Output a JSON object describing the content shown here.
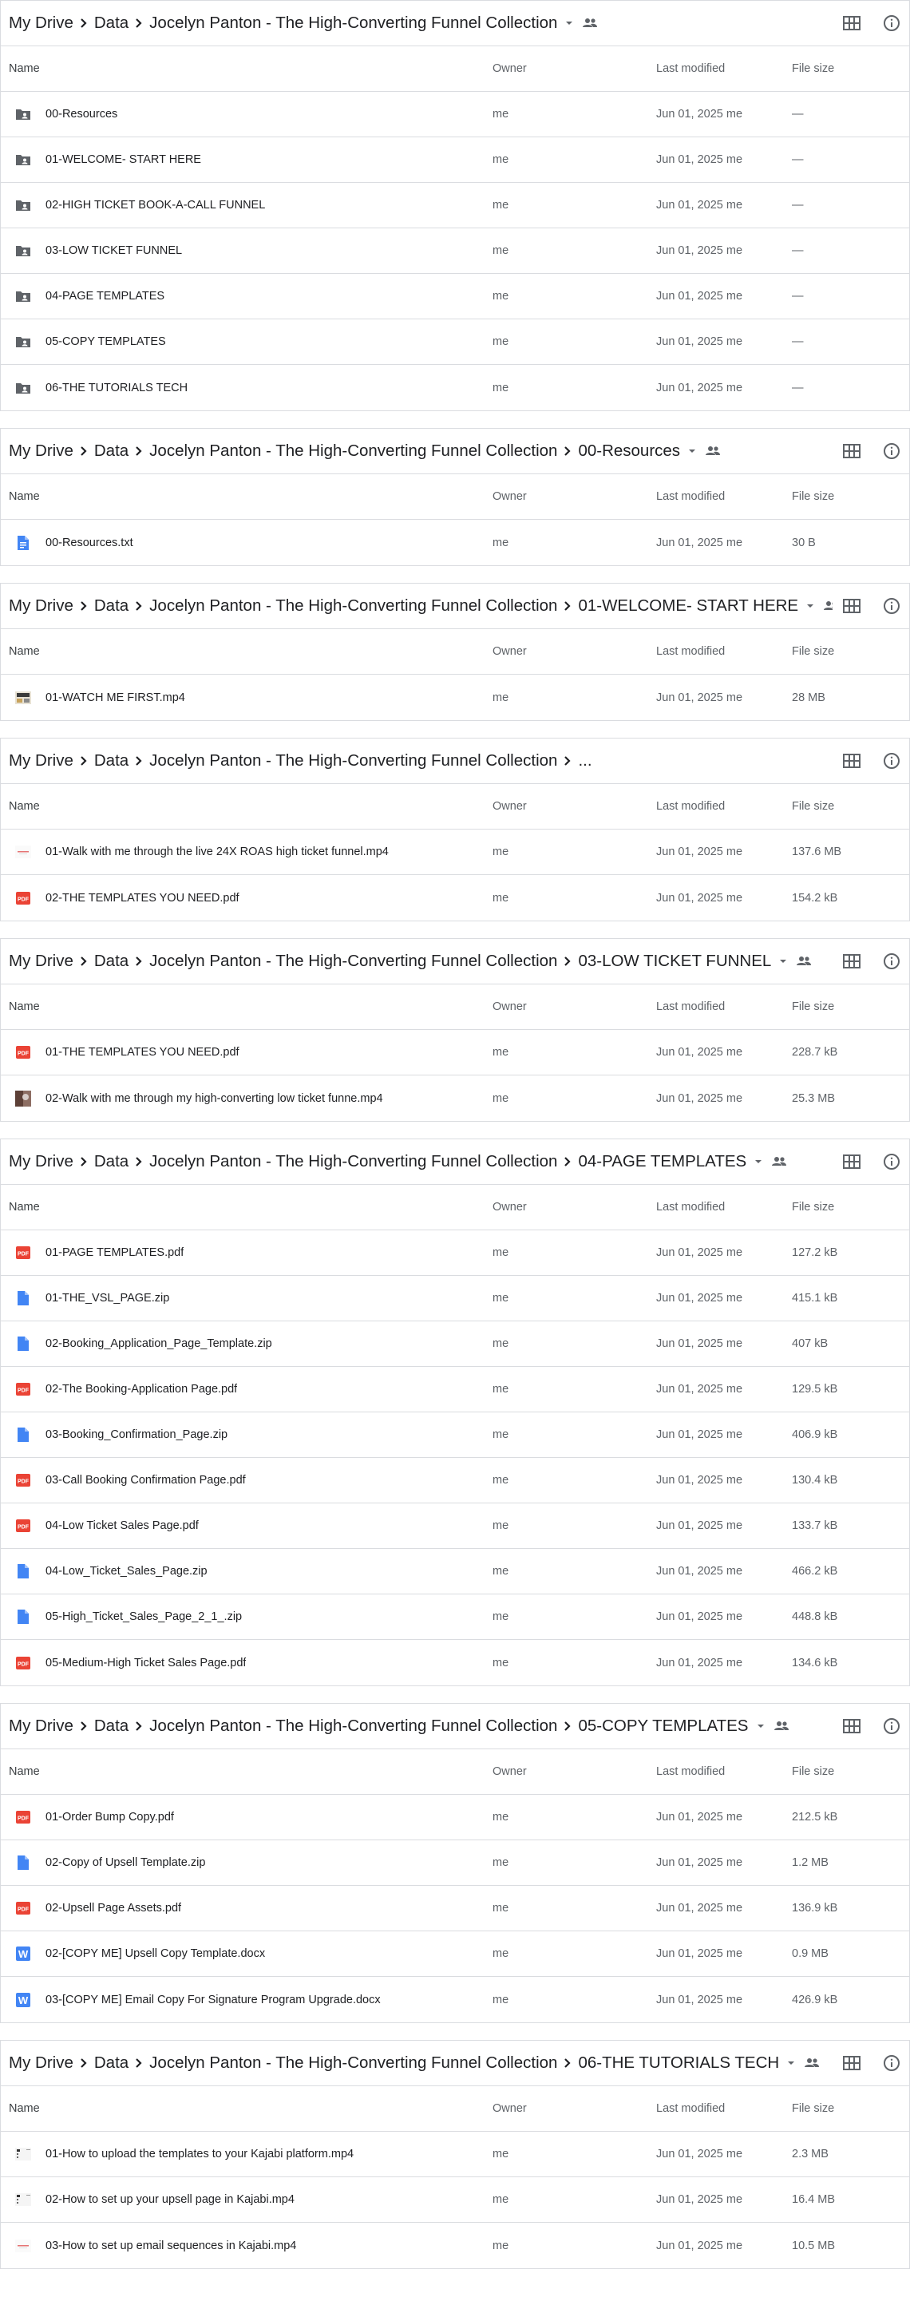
{
  "columns": {
    "name": "Name",
    "owner": "Owner",
    "modified": "Last modified",
    "size": "File size"
  },
  "colors": {
    "folder": "#5f6368",
    "doc": "#4285f4",
    "pdf": "#ea4335",
    "word": "#4285f4"
  },
  "sections": [
    {
      "crumbs": [
        "My Drive",
        "Data",
        "Jocelyn Panton - The High-Converting Funnel Collection"
      ],
      "has_menu": true,
      "rows": [
        {
          "icon": "folder-shared-icon",
          "name": "00-Resources",
          "owner": "me",
          "modified": "Jun 01, 2025 me",
          "size": "—"
        },
        {
          "icon": "folder-shared-icon",
          "name": "01-WELCOME- START HERE",
          "owner": "me",
          "modified": "Jun 01, 2025 me",
          "size": "—"
        },
        {
          "icon": "folder-shared-icon",
          "name": "02-HIGH TICKET BOOK-A-CALL FUNNEL",
          "owner": "me",
          "modified": "Jun 01, 2025 me",
          "size": "—"
        },
        {
          "icon": "folder-shared-icon",
          "name": "03-LOW TICKET FUNNEL",
          "owner": "me",
          "modified": "Jun 01, 2025 me",
          "size": "—"
        },
        {
          "icon": "folder-shared-icon",
          "name": "04-PAGE TEMPLATES",
          "owner": "me",
          "modified": "Jun 01, 2025 me",
          "size": "—"
        },
        {
          "icon": "folder-shared-icon",
          "name": "05-COPY TEMPLATES",
          "owner": "me",
          "modified": "Jun 01, 2025 me",
          "size": "—"
        },
        {
          "icon": "folder-shared-icon",
          "name": "06-THE TUTORIALS TECH",
          "owner": "me",
          "modified": "Jun 01, 2025 me",
          "size": "—"
        }
      ]
    },
    {
      "crumbs": [
        "My Drive",
        "Data",
        "Jocelyn Panton - The High-Converting Funnel Collection",
        "00-Resources"
      ],
      "has_menu": true,
      "rows": [
        {
          "icon": "doc-icon",
          "name": "00-Resources.txt",
          "owner": "me",
          "modified": "Jun 01, 2025 me",
          "size": "30 B"
        }
      ]
    },
    {
      "crumbs": [
        "My Drive",
        "Data",
        "Jocelyn Panton - The High-Converting Funnel Collection",
        "01-WELCOME- START HERE"
      ],
      "has_menu": true,
      "rows": [
        {
          "icon": "video-thumb-icon",
          "name": "01-WATCH ME FIRST.mp4",
          "owner": "me",
          "modified": "Jun 01, 2025 me",
          "size": "28 MB"
        }
      ]
    },
    {
      "crumbs": [
        "My Drive",
        "Data",
        "Jocelyn Panton - The High-Converting Funnel Collection",
        "..."
      ],
      "has_menu": false,
      "rows": [
        {
          "icon": "video-thumb-light-icon",
          "name": "01-Walk with me through the live 24X ROAS high ticket funnel.mp4",
          "owner": "me",
          "modified": "Jun 01, 2025 me",
          "size": "137.6 MB"
        },
        {
          "icon": "pdf-icon",
          "name": "02-THE TEMPLATES YOU NEED.pdf",
          "owner": "me",
          "modified": "Jun 01, 2025 me",
          "size": "154.2 kB"
        }
      ]
    },
    {
      "crumbs": [
        "My Drive",
        "Data",
        "Jocelyn Panton - The High-Converting Funnel Collection",
        "03-LOW TICKET FUNNEL"
      ],
      "has_menu": true,
      "rows": [
        {
          "icon": "pdf-icon",
          "name": "01-THE TEMPLATES YOU NEED.pdf",
          "owner": "me",
          "modified": "Jun 01, 2025 me",
          "size": "228.7 kB"
        },
        {
          "icon": "video-thumb-photo-icon",
          "name": "02-Walk with me through my high-converting low ticket funne.mp4",
          "owner": "me",
          "modified": "Jun 01, 2025 me",
          "size": "25.3 MB"
        }
      ]
    },
    {
      "crumbs": [
        "My Drive",
        "Data",
        "Jocelyn Panton - The High-Converting Funnel Collection",
        "04-PAGE TEMPLATES"
      ],
      "has_menu": true,
      "rows": [
        {
          "icon": "pdf-icon",
          "name": "01-PAGE TEMPLATES.pdf",
          "owner": "me",
          "modified": "Jun 01, 2025 me",
          "size": "127.2 kB"
        },
        {
          "icon": "file-icon",
          "name": "01-THE_VSL_PAGE.zip",
          "owner": "me",
          "modified": "Jun 01, 2025 me",
          "size": "415.1 kB"
        },
        {
          "icon": "file-icon",
          "name": "02-Booking_Application_Page_Template.zip",
          "owner": "me",
          "modified": "Jun 01, 2025 me",
          "size": "407 kB"
        },
        {
          "icon": "pdf-icon",
          "name": "02-The Booking-Application Page.pdf",
          "owner": "me",
          "modified": "Jun 01, 2025 me",
          "size": "129.5 kB"
        },
        {
          "icon": "file-icon",
          "name": "03-Booking_Confirmation_Page.zip",
          "owner": "me",
          "modified": "Jun 01, 2025 me",
          "size": "406.9 kB"
        },
        {
          "icon": "pdf-icon",
          "name": "03-Call Booking Confirmation Page.pdf",
          "owner": "me",
          "modified": "Jun 01, 2025 me",
          "size": "130.4 kB"
        },
        {
          "icon": "pdf-icon",
          "name": "04-Low Ticket Sales Page.pdf",
          "owner": "me",
          "modified": "Jun 01, 2025 me",
          "size": "133.7 kB"
        },
        {
          "icon": "file-icon",
          "name": "04-Low_Ticket_Sales_Page.zip",
          "owner": "me",
          "modified": "Jun 01, 2025 me",
          "size": "466.2 kB"
        },
        {
          "icon": "file-icon",
          "name": "05-High_Ticket_Sales_Page_2_1_.zip",
          "owner": "me",
          "modified": "Jun 01, 2025 me",
          "size": "448.8 kB"
        },
        {
          "icon": "pdf-icon",
          "name": "05-Medium-High Ticket Sales Page.pdf",
          "owner": "me",
          "modified": "Jun 01, 2025 me",
          "size": "134.6 kB"
        }
      ]
    },
    {
      "crumbs": [
        "My Drive",
        "Data",
        "Jocelyn Panton - The High-Converting Funnel Collection",
        "05-COPY TEMPLATES"
      ],
      "has_menu": true,
      "rows": [
        {
          "icon": "pdf-icon",
          "name": "01-Order Bump Copy.pdf",
          "owner": "me",
          "modified": "Jun 01, 2025 me",
          "size": "212.5 kB"
        },
        {
          "icon": "file-icon",
          "name": "02-Copy of Upsell Template.zip",
          "owner": "me",
          "modified": "Jun 01, 2025 me",
          "size": "1.2 MB"
        },
        {
          "icon": "pdf-icon",
          "name": "02-Upsell Page Assets.pdf",
          "owner": "me",
          "modified": "Jun 01, 2025 me",
          "size": "136.9 kB"
        },
        {
          "icon": "word-icon",
          "name": "02-[COPY ME] Upsell Copy Template.docx",
          "owner": "me",
          "modified": "Jun 01, 2025 me",
          "size": "0.9 MB"
        },
        {
          "icon": "word-icon",
          "name": "03-[COPY ME] Email Copy For Signature Program Upgrade.docx",
          "owner": "me",
          "modified": "Jun 01, 2025 me",
          "size": "426.9 kB"
        }
      ]
    },
    {
      "crumbs": [
        "My Drive",
        "Data",
        "Jocelyn Panton - The High-Converting Funnel Collection",
        "06-THE TUTORIALS TECH"
      ],
      "has_menu": true,
      "rows": [
        {
          "icon": "video-thumb-screen-icon",
          "name": "01-How to upload the templates to your Kajabi platform.mp4",
          "owner": "me",
          "modified": "Jun 01, 2025 me",
          "size": "2.3 MB"
        },
        {
          "icon": "video-thumb-screen-icon",
          "name": "02-How to set up your upsell page in Kajabi.mp4",
          "owner": "me",
          "modified": "Jun 01, 2025 me",
          "size": "16.4 MB"
        },
        {
          "icon": "video-thumb-light-icon",
          "name": "03-How to set up email sequences in Kajabi.mp4",
          "owner": "me",
          "modified": "Jun 01, 2025 me",
          "size": "10.5 MB"
        }
      ]
    }
  ]
}
